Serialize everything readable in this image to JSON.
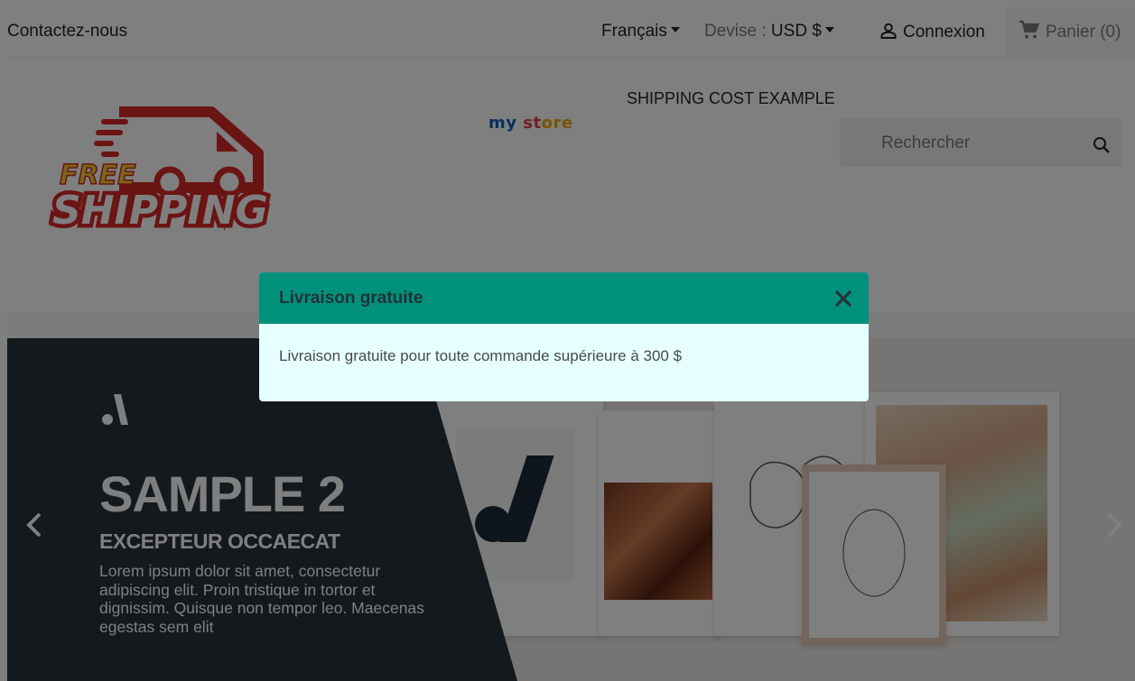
{
  "topnav": {
    "contact_label": "Contactez-nous",
    "language_label": "Français",
    "currency_prefix": "Devise : ",
    "currency_value": "USD $",
    "login_label": "Connexion",
    "cart_label": "Panier (0)"
  },
  "header": {
    "logo_line1": "FREE",
    "logo_line2": "SHIPPING",
    "store_name_parts": [
      "my",
      " ",
      "st",
      "ore"
    ],
    "menu_item": "SHIPPING COST EXAMPLE",
    "search_placeholder": "Rechercher"
  },
  "slider": {
    "title": "SAMPLE 2",
    "subtitle": "EXCEPTEUR OCCAECAT",
    "text": "Lorem ipsum dolor sit amet, consectetur adipiscing elit. Proin tristique in tortor et dignissim. Quisque non tempor leo. Maecenas egestas sem elit"
  },
  "modal": {
    "title": "Livraison gratuite",
    "body": "Livraison gratuite pour toute commande supérieure à 300 $"
  },
  "colors": {
    "modal_header": "#00917c",
    "modal_body": "#e6ffff",
    "logo_red": "#d62828",
    "logo_yellow": "#f7d02c",
    "slide_dark": "#263238"
  },
  "icons": [
    "user-icon",
    "cart-icon",
    "search-icon",
    "close-icon",
    "chevron-left-icon",
    "chevron-right-icon",
    "truck-icon"
  ]
}
